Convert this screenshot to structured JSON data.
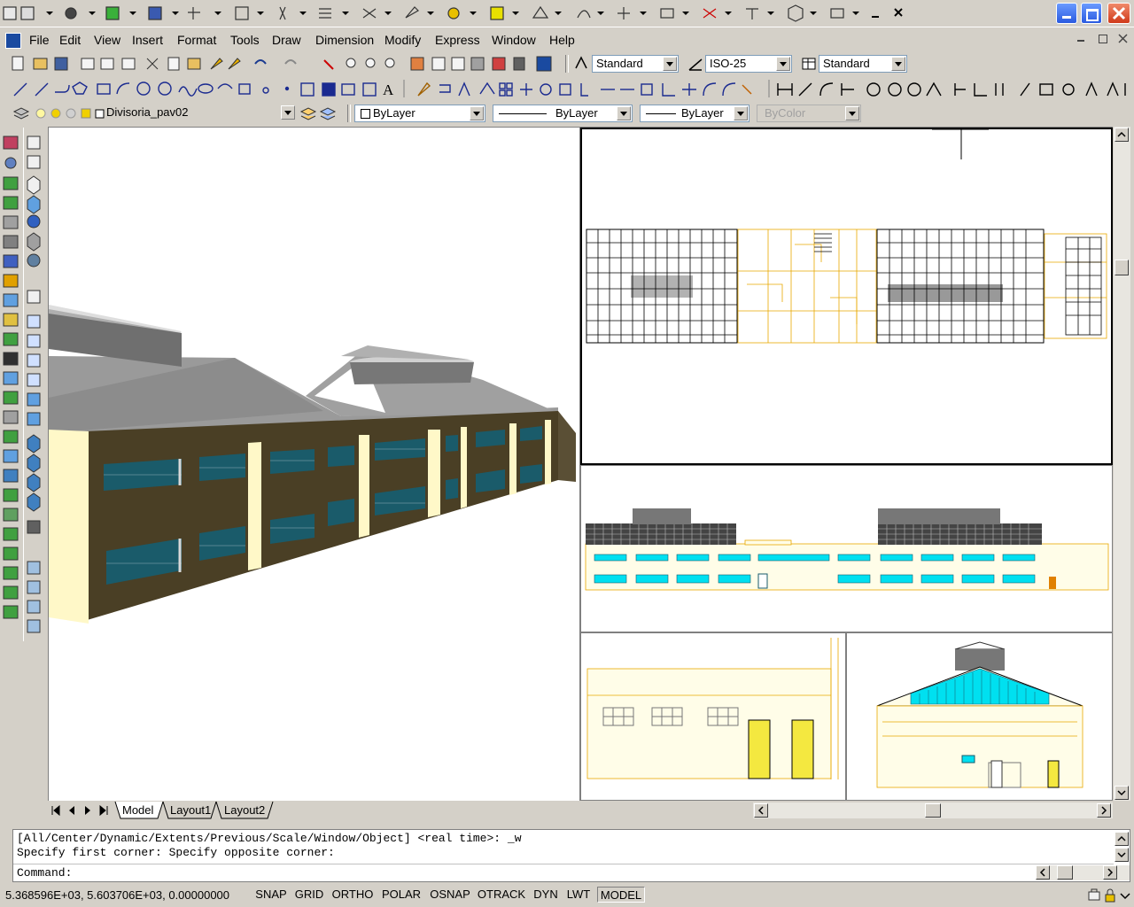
{
  "menu": [
    "File",
    "Edit",
    "View",
    "Insert",
    "Format",
    "Tools",
    "Draw",
    "Dimension",
    "Modify",
    "Express",
    "Window",
    "Help"
  ],
  "styles": {
    "text_style": "Standard",
    "dim_style": "ISO-25",
    "table_style": "Standard"
  },
  "layer": {
    "current": "Divisoria_pav02",
    "color": "ByLayer",
    "linetype": "ByLayer",
    "lineweight": "ByLayer",
    "plot_style": "ByColor"
  },
  "tabs": [
    "Model",
    "Layout1",
    "Layout2"
  ],
  "command": {
    "line1": "[All/Center/Dynamic/Extents/Previous/Scale/Window/Object] <real time>: _w",
    "line2": "Specify first corner: Specify opposite corner:",
    "prompt": "Command:"
  },
  "status": {
    "coords": "5.368596E+03, 5.603706E+03, 0.00000000",
    "buttons": [
      "SNAP",
      "GRID",
      "ORTHO",
      "POLAR",
      "OSNAP",
      "OTRACK",
      "DYN",
      "LWT",
      "MODEL"
    ]
  },
  "colors": {
    "face": "#d4d0c8",
    "wall": "#4a3f25",
    "glass": "#1a5b6a",
    "column": "#fff8c8",
    "cad_line": "#e8a800",
    "cyan": "#00e0f0"
  }
}
